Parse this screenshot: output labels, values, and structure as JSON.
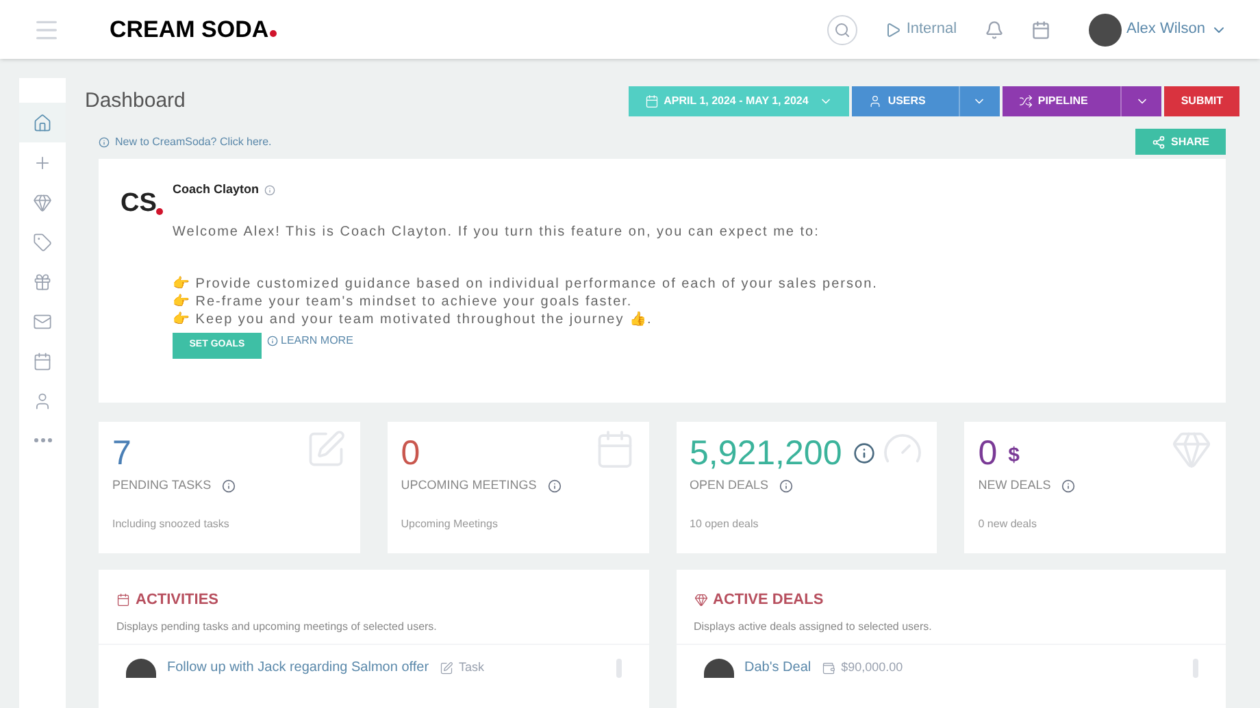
{
  "header": {
    "logo": "CREAM SODA",
    "env": "Internal",
    "user": "Alex Wilson"
  },
  "sidebar": {
    "items": [
      {
        "selected": true
      },
      {
        "selected": false
      },
      {
        "selected": false
      },
      {
        "selected": false
      },
      {
        "selected": false
      },
      {
        "selected": false
      },
      {
        "selected": false
      },
      {
        "selected": false
      },
      {
        "selected": false
      }
    ]
  },
  "page_title": "Dashboard",
  "toolbar": [
    {
      "label": "APRIL 1, 2024 - MAY 1, 2024",
      "color": "#52cfc4",
      "kind": "range"
    },
    {
      "label": "USERS",
      "color": "#4a90d2",
      "kind": "split"
    },
    {
      "label": "PIPELINE",
      "color": "#8e3aaf",
      "kind": "split"
    },
    {
      "label": "SUBMIT",
      "color": "#d9333f",
      "kind": "plain"
    }
  ],
  "new_link": "New to CreamSoda? Click here.",
  "share": "SHARE",
  "coach": {
    "logo": "CS",
    "name": "Coach Clayton",
    "intro": "Welcome Alex! This is Coach Clayton. If you turn this feature on, you can expect me to:",
    "points": [
      "👉 Provide customized guidance based on individual performance of each of your sales person.",
      "👉 Re-frame your team's mindset to achieve your goals faster.",
      "👉 Keep you and your team motivated throughout the journey 👍."
    ],
    "button": "SET GOALS",
    "learn_more": "LEARN MORE"
  },
  "stats": [
    {
      "value": "7",
      "color": "#4a7fb5",
      "label": "PENDING TASKS",
      "sub": "Including snoozed tasks",
      "kind": "plain"
    },
    {
      "value": "0",
      "color": "#c9574e",
      "label": "UPCOMING MEETINGS",
      "sub": "Upcoming Meetings",
      "kind": "plain"
    },
    {
      "value": "5,921,200",
      "color": "#3bb39b",
      "label": "OPEN DEALS",
      "sub": "10 open deals",
      "kind": "info"
    },
    {
      "value": "0",
      "color": "#7a3a96",
      "label": "NEW DEALS",
      "sub": "0 new deals",
      "kind": "currency",
      "suffix": "$"
    }
  ],
  "panels": [
    {
      "title": "ACTIVITIES",
      "desc": "Displays pending tasks and upcoming meetings of selected users.",
      "row": {
        "title": "Follow up with Jack regarding Salmon offer",
        "meta": "Task"
      }
    },
    {
      "title": "ACTIVE DEALS",
      "desc": "Displays active deals assigned to selected users.",
      "row": {
        "title": "Dab's Deal",
        "meta": "$90,000.00"
      }
    }
  ]
}
